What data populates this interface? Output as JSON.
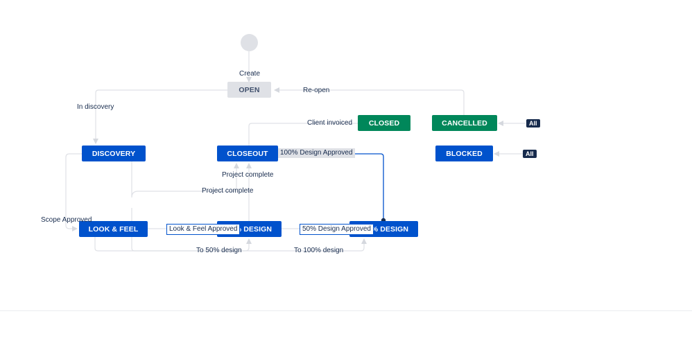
{
  "diagram": {
    "statuses": {
      "open": "OPEN",
      "discovery": "DISCOVERY",
      "look_feel": "LOOK & FEEL",
      "design50": "50% DESIGN",
      "design100": "100% DESIGN",
      "closeout": "CLOSEOUT",
      "closed": "CLOSED",
      "cancelled": "CANCELLED",
      "blocked": "BLOCKED"
    },
    "transitions": {
      "create": "Create",
      "re_open": "Re-open",
      "in_discovery": "In discovery",
      "client_invoiced": "Client invoiced",
      "design100_approved": "100% Design Approved",
      "project_complete_a": "Project complete",
      "project_complete_b": "Project complete",
      "scope_approved": "Scope Approved",
      "look_feel_approved": "Look & Feel Approved",
      "design50_approved": "50% Design Approved",
      "to_50": "To 50% design",
      "to_100": "To 100% design",
      "all_cancelled": "All",
      "all_blocked": "All"
    },
    "colors": {
      "todo": "#dfe1e6",
      "in_progress": "#0052cc",
      "done": "#00875a",
      "connector": "#dfe1e6",
      "highlight": "#0052cc",
      "badge": "#172b4d"
    }
  }
}
